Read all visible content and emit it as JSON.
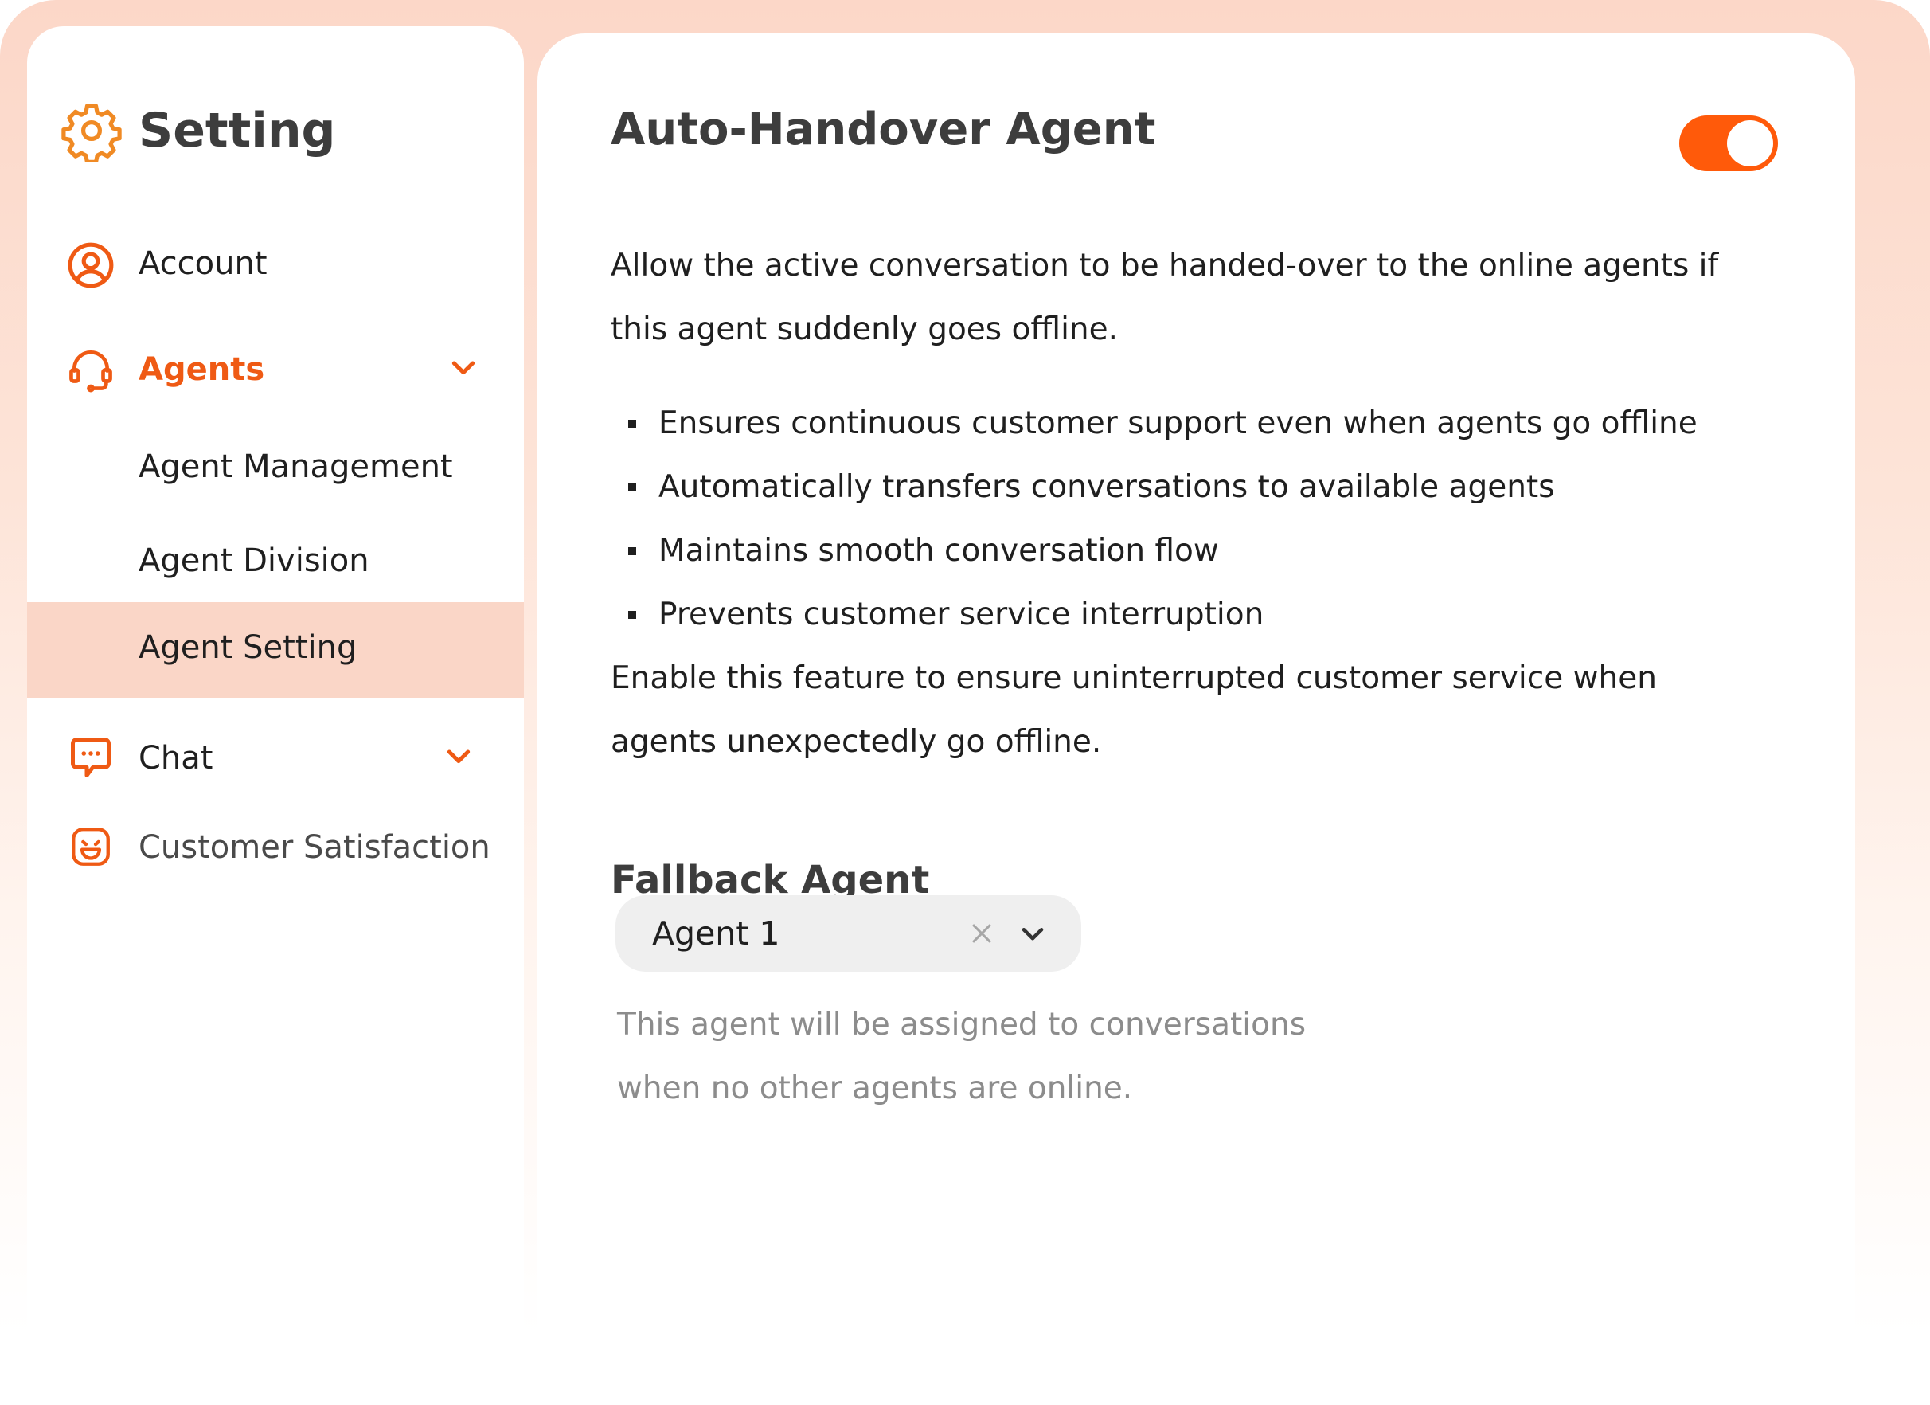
{
  "colors": {
    "accent": "#ef5a14",
    "toggle_on": "#ff5a0a",
    "selected_bg": "#fad6c7",
    "icon_header": "#f08a24"
  },
  "sidebar": {
    "title": "Setting",
    "title_icon": "gear-icon",
    "items": [
      {
        "label": "Account",
        "icon": "user-circle-icon"
      },
      {
        "label": "Agents",
        "icon": "headset-icon",
        "expanded": true,
        "active": true,
        "children": [
          {
            "label": "Agent Management"
          },
          {
            "label": "Agent Division"
          },
          {
            "label": "Agent Setting",
            "selected": true
          }
        ]
      },
      {
        "label": "Chat",
        "icon": "chat-bubble-icon",
        "expanded": false
      },
      {
        "label": "Customer Satisfaction",
        "icon": "smiley-icon"
      }
    ]
  },
  "main": {
    "title": "Auto-Handover Agent",
    "toggle_on": true,
    "description_line1": "Allow the active conversation to be handed-over to the online agents if",
    "description_line2": "this agent suddenly goes offline.",
    "bullets": [
      "Ensures continuous customer support even when agents go offline",
      "Automatically transfers conversations to available agents",
      "Maintains smooth conversation flow",
      "Prevents customer service interruption"
    ],
    "closing_line1": "Enable this feature to ensure uninterrupted customer service when",
    "closing_line2": "agents unexpectedly go offline.",
    "fallback": {
      "title": "Fallback Agent",
      "selected_value": "Agent 1",
      "help_line1": "This agent will be assigned to conversations",
      "help_line2": "when no other agents are online."
    }
  }
}
